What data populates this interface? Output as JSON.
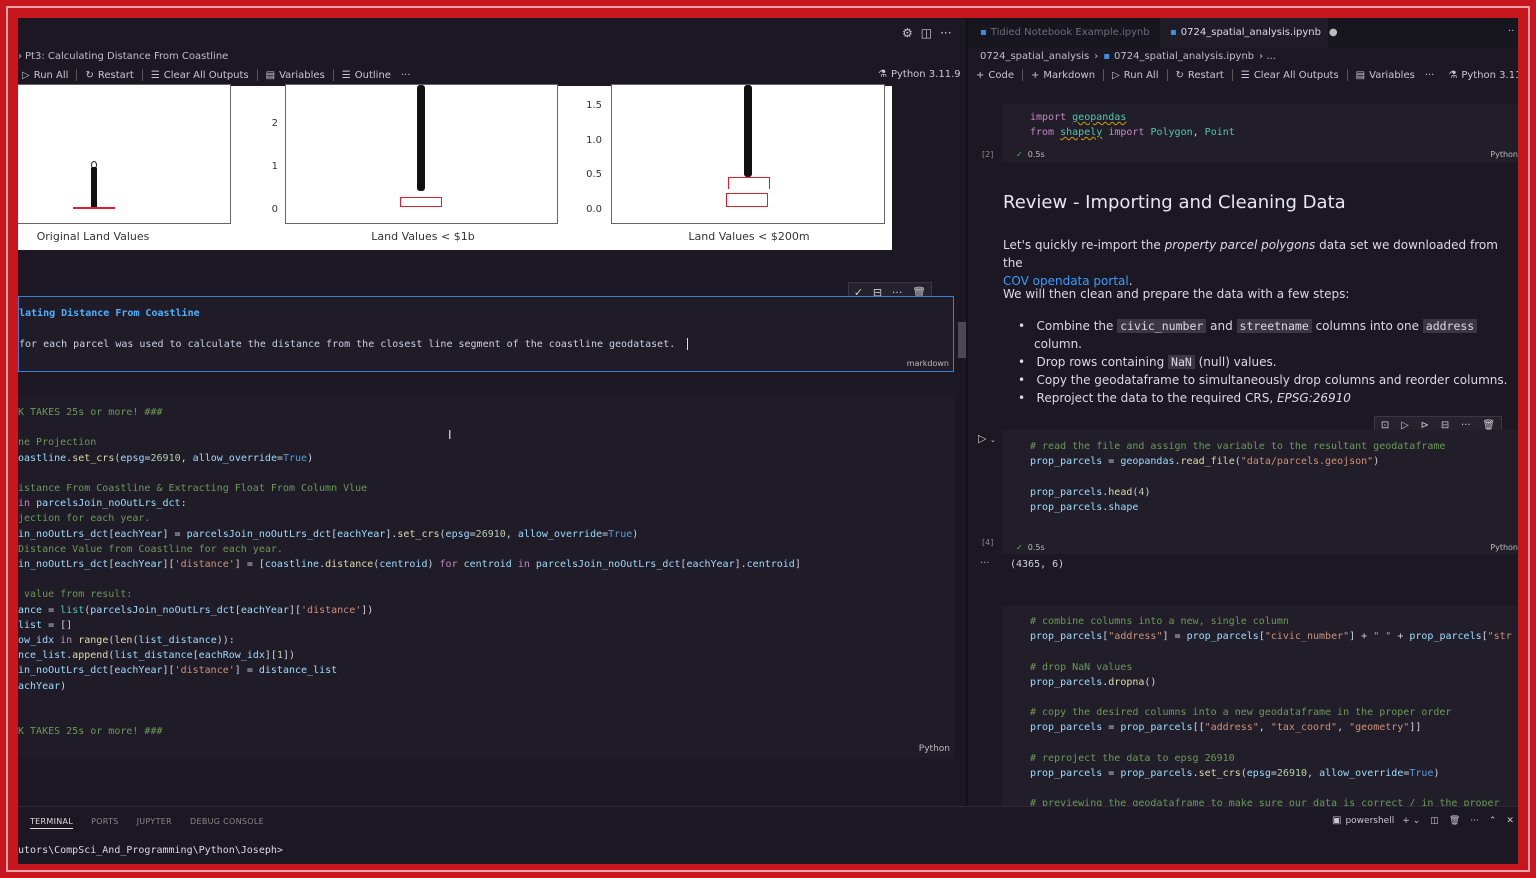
{
  "left": {
    "breadcrumb": "Pt3: Calculating Distance From Coastline",
    "toolbar": {
      "run_all": "Run All",
      "restart": "Restart",
      "clear": "Clear All Outputs",
      "variables": "Variables",
      "outline": "Outline",
      "kernel": "Python 3.11.9"
    },
    "figure": {
      "captions": [
        "Original Land Values",
        "Land Values < $1b",
        "Land Values < $200m"
      ],
      "ticks2": [
        "2",
        "1",
        "0"
      ],
      "ticks3": [
        "1.5",
        "1.0",
        "0.5",
        "0.0"
      ]
    },
    "md_cell": {
      "title": "lating Distance From Coastline",
      "body": "for each parcel was used to calculate the distance from the closest line segment of the coastline geodataset.",
      "type": "markdown"
    },
    "code_cell": {
      "lang": "Python"
    }
  },
  "right": {
    "tabs": [
      "Tidied Notebook Example.ipynb",
      "0724_spatial_analysis.ipynb"
    ],
    "breadcrumb": [
      "0724_spatial_analysis",
      "0724_spatial_analysis.ipynb"
    ],
    "toolbar": {
      "code": "Code",
      "markdown": "Markdown",
      "run_all": "Run All",
      "restart": "Restart",
      "clear": "Clear All Outputs",
      "variables": "Variables",
      "kernel": "Python 3.11"
    },
    "cell1": {
      "num": "[2]",
      "time": "0.5s",
      "lang": "Python"
    },
    "heading": "Review - Importing and Cleaning Data",
    "para1_a": "Let's quickly re-import the ",
    "para1_em": "property parcel polygons",
    "para1_b": " data set we downloaded from the",
    "para1_link": "COV opendata portal",
    "para2": "We will then clean and prepare the data with a few steps:",
    "bullets": {
      "b1a": "Combine the ",
      "b1c1": "civic_number",
      "b1b": " and ",
      "b1c2": "streetname",
      "b1c": " columns into one ",
      "b1c3": "address",
      "b1d": "column.",
      "b2a": "Drop rows containing ",
      "b2c": "NaN",
      "b2b": " (null) values.",
      "b3": "Copy the geodataframe to simultaneously drop columns and reorder columns.",
      "b4a": "Reproject the data to the required CRS, ",
      "b4em": "EPSG:26910"
    },
    "cell2": {
      "num": "[4]",
      "time": "0.5s",
      "lang": "Python",
      "output": "(4365, 6)"
    }
  },
  "terminal": {
    "tabs": [
      "TERMINAL",
      "PORTS",
      "JUPYTER",
      "DEBUG CONSOLE"
    ],
    "shell": "powershell",
    "prompt": "utors\\CompSci_And_Programming\\Python\\Joseph>"
  }
}
